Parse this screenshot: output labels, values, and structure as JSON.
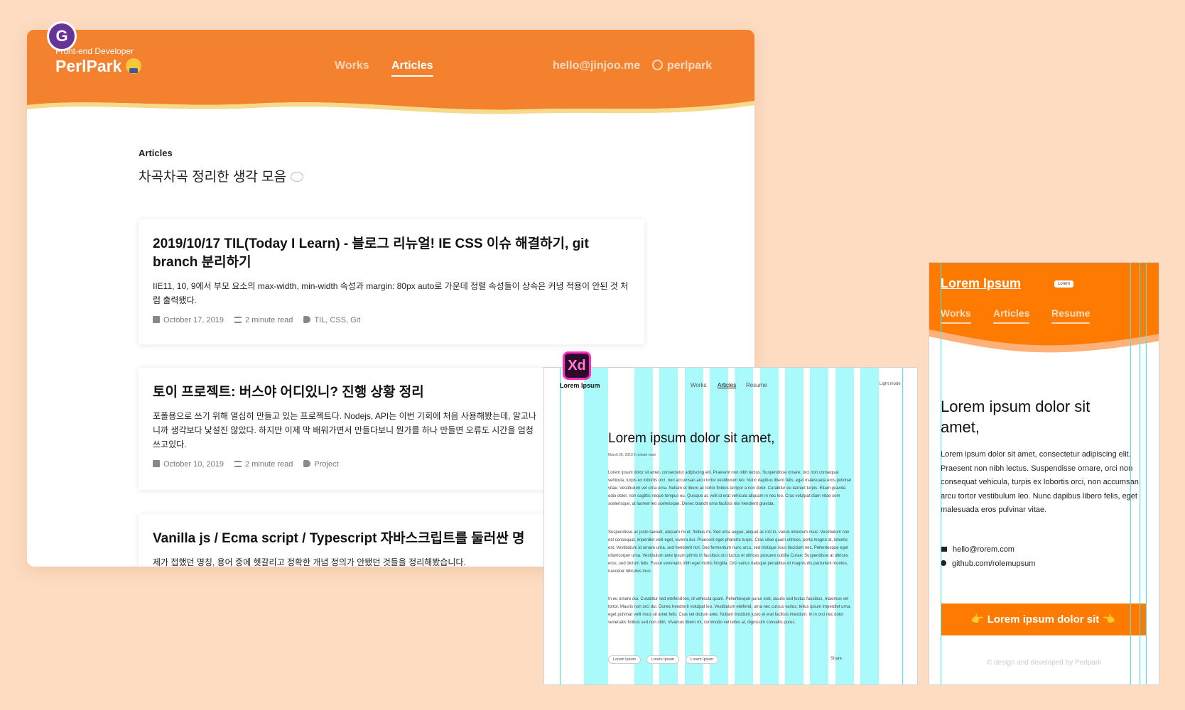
{
  "main_window": {
    "brand_subtitle": "Front-end Developer",
    "brand_name": "PerlPark",
    "gatsby_letter": "G",
    "nav": [
      "Works",
      "Articles"
    ],
    "email": "hello@jinjoo.me",
    "github": "perlpark",
    "section_label": "Articles",
    "section_subtitle": "차곡차곡 정리한 생각 모음",
    "cards": [
      {
        "title": "2019/10/17 TIL(Today I Learn) - 블로그 리뉴얼! IE CSS 이슈 해결하기, git branch 분리하기",
        "desc": "IIE11, 10, 9에서 부모 요소의 max-width, min-width 속성과 margin: 80px auto로 가운데 정렬 속성들이 상속은 커녕 적용이 안된 것 처럼 출력됐다.",
        "date": "October 17, 2019",
        "read": "2 minute read",
        "tags": "TIL, CSS, Git"
      },
      {
        "title": "토이 프로젝트: 버스야 어디있니? 진행 상황 정리",
        "desc": "포폴용으로 쓰기 위해 열심히 만들고 있는 프로젝트다. Nodejs, API는 이번 기회에 처음 사용해봤는데, 알고나니까 생각보다 낯설진 않았다. 하지만 이제 막 배워가면서 만들다보니 뭔가를 하나 만들면 오류도 시간을 엄청 쓰고있다.",
        "date": "October 10, 2019",
        "read": "2 minute read",
        "tags": "Project"
      },
      {
        "title": "Vanilla js / Ecma script / Typescript 자바스크립트를 둘러싼 명",
        "desc": "제가 접했던 명칭, 용어 중에 헷갈리고 정확한 개념 정의가 안됐던 것들을 정리해봤습니다."
      }
    ]
  },
  "xd_window": {
    "badge": "Xd",
    "logo": "Lorem Ipsum",
    "nav": [
      "Works",
      "Articles",
      "Resume"
    ],
    "mode": "Light mode",
    "title": "Lorem ipsum dolor sit amet,",
    "meta": "March 26, 2019   2 minute read",
    "paragraphs": [
      "Lorem ipsum dolor sit amet, consectetur adipiscing elit. Praesent non nibh lectus. Suspendisse ornare, orci non consequat vehicula, turpis ex lobortis orci, non accumsan arcu tortor vestibulum leo. Nunc dapibus libero felis, eget malesuada eros pulvinar vitae. Vestibulum vel urna urna. Nullam et libero ac tortor finibus tempor a non dolor. Curabitur eu laoreet turpis. Etiam gravida odio dolor, non sagittis neque tempus eu. Quisque ac velit id erat vehicula aliquam in nec leo. Cras volutpat diam vitae sem scelerisque, at laoreet leo scelerisque. Donec blandit urna facilisis nisi hendrerit gravida.",
      "Suspendisse ac justo laoreet, aliquam mi et, finibus mi. Sed urna augue, aliquet ac nisl in, varius interdum risus. Vestibulum non est consequat, imperdiet velit eget, viverra dui. Praesent eget pharetra turpis. Cras vitae quam ultrices, porta magna at, lobortis est. Vestibulum id ornare urna, sed hendrerit nisl. Sed fermentum nunc arcu, sed tristique risus tincidunt nec. Pellentesque eget ullamcorper urna. Vestibulum ante ipsum primis in faucibus orci luctus et ultrices posuere cubilia Curae; Suspendisse at ultrices eros, sed dictum felis. Fusce venenatis nibh eget mollis fringilla. Orci varius natoque penatibus et magnis dis parturient montes, nascetur ridiculus mus.",
      "In eu ornare dui. Curabitur sed eleifend leo, id vehicula quam. Pellentesque purus erat, iaculis sed luctus faucibus, maximus vel tortor. Mauris non orci dui. Donec hendrerit volutpat leo. Vestibulum eleifend, urna nec cursus varius, tellus ipsum imperdiet urna, eget pulvinar velit risus sit amet felis. Cras vel dictum ante. Nullam tincidunt justo et erat facilisis interdum. In in orci nec dolor venenatis finibus sed non nibh. Vivamus libero mi, commodo vel tellus at, dignissim convallis purus."
    ],
    "tags": [
      "Lorem Ipsum",
      "Lorem Ipsum",
      "Lorem Ipsum"
    ],
    "share": "Share"
  },
  "mobile_window": {
    "brand": "Lorem Ipsum",
    "badge": "Lorem",
    "nav": [
      "Works",
      "Articles",
      "Resume"
    ],
    "heading": "Lorem ipsum dolor sit amet,",
    "paragraph": "Lorem ipsum dolor sit amet, consectetur adipiscing elit. Praesent non nibh lectus. Suspendisse ornare, orci non consequat vehicula, turpis ex lobortis orci, non accumsan arcu tortor vestibulum leo. Nunc dapibus libero felis, eget malesuada eros pulvinar vitae.",
    "email": "hello@rorem.com",
    "github": "github.com/rolemupsum",
    "button": "👉 Lorem ipsum dolor sit 👈",
    "footer": "© design and developed by Perlpark"
  },
  "colors": {
    "background": "#fddcc1",
    "header_orange": "#f3812e",
    "wave_yellow": "#f7d98a",
    "mobile_orange": "#ff7a00",
    "grid_cyan": "#aafafb",
    "gatsby_purple": "#663399",
    "xd_pink": "#ff2bc2"
  }
}
